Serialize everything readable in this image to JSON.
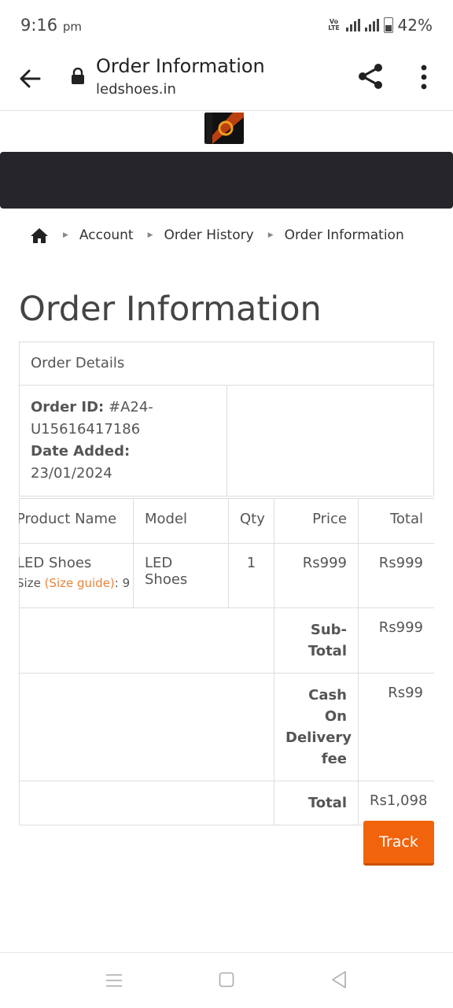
{
  "status": {
    "time": "9:16",
    "ampm": "pm",
    "network": "VoLTE",
    "battery": "42%"
  },
  "browser": {
    "title": "Order Information",
    "url": "ledshoes.in"
  },
  "breadcrumb": {
    "items": [
      "Account",
      "Order History",
      "Order Information"
    ]
  },
  "page": {
    "heading": "Order Information"
  },
  "order_details": {
    "header": "Order Details",
    "order_id_label": "Order ID:",
    "order_id_value": "#A24-U15616417186",
    "date_label": "Date Added:",
    "date_value": "23/01/2024"
  },
  "products": {
    "headers": {
      "name": "Product Name",
      "model": "Model",
      "qty": "Qty",
      "price": "Price",
      "total": "Total"
    },
    "row": {
      "name": "LED Shoes",
      "option_label": "Size",
      "size_guide": "(Size guide)",
      "option_value": ": 9",
      "model": "LED Shoes",
      "qty": "1",
      "price": "Rs999",
      "total": "Rs999"
    },
    "totals": [
      {
        "label": "Sub-Total",
        "value": "Rs999"
      },
      {
        "label": "Cash On Delivery fee",
        "value": "Rs99"
      },
      {
        "label": "Total",
        "value": "Rs1,098"
      }
    ]
  },
  "actions": {
    "track": "Track"
  },
  "colors": {
    "accent": "#f2640c",
    "size_guide": "#e8833a",
    "nav_strip": "#25252a"
  }
}
